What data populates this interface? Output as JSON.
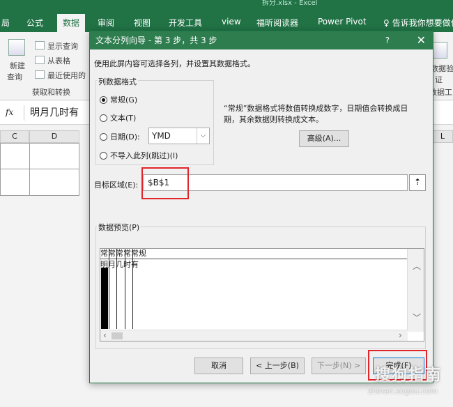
{
  "app_title": "拆分.xlsx - Excel",
  "ribbon_tabs": [
    "局",
    "公式",
    "数据",
    "审阅",
    "视图",
    "开发工具",
    "view",
    "福昕阅读器",
    "Power Pivot",
    "告诉我你想要做什"
  ],
  "ribbon_active_tab": "数据",
  "ribbon": {
    "show_query": "显示查询",
    "from_table": "从表格",
    "recent_sources": "最近使用的",
    "new_query_line1": "新建",
    "new_query_line2": "查询",
    "group_label": "获取和转换",
    "right_label1": "数据验",
    "right_label2": "证",
    "right_label3": "数据工"
  },
  "formula_bar": {
    "fx": "fx",
    "content": "明月几时有"
  },
  "columns": [
    "C",
    "D",
    "L"
  ],
  "dialog": {
    "title": "文本分列向导 - 第 3 步，共 3 步",
    "help": "?",
    "close": "✕",
    "description": "使用此屏内容可选择各列，并设置其数据格式。",
    "format_group_title": "列数据格式",
    "options": {
      "general": "常规(G)",
      "text": "文本(T)",
      "date": "日期(D):",
      "skip": "不导入此列(跳过)(I)"
    },
    "date_format": "YMD",
    "info_text": "“常规”数据格式将数值转换成数字，日期值会转换成日期，其余数据则转换成文本。",
    "advanced_button": "高级(A)...",
    "destination_label": "目标区域(E):",
    "destination_value": "$B$1",
    "preview_title": "数据预览(P)",
    "preview_header": "常常常常常规",
    "preview_row": "明月几时有",
    "buttons": {
      "cancel": "取消",
      "back": "< 上一步(B)",
      "next": "下一步(N) >",
      "finish": "完成(F)"
    }
  },
  "watermark": {
    "brand": "搜狗指南",
    "url": "zhinan.sogou.com"
  },
  "colors": {
    "excel_green": "#217346",
    "highlight_red": "#e0252b"
  }
}
